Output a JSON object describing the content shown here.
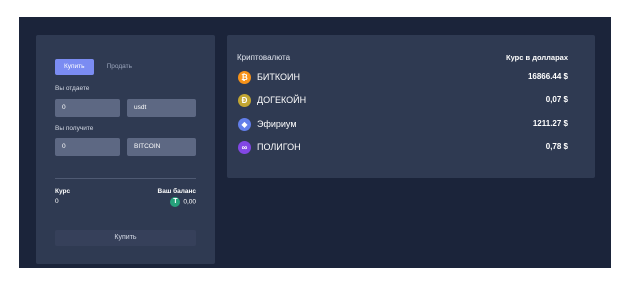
{
  "trade": {
    "tabs": [
      {
        "label": "Купить",
        "active": true
      },
      {
        "label": "Продать",
        "active": false
      }
    ],
    "give_label": "Вы отдаете",
    "give_amount": "0",
    "give_currency": "usdt",
    "ratio_label": "Вы получите",
    "receive_amount": "0",
    "receive_currency": "BITCOIN",
    "rate_label": "Курс",
    "rate_value": "0",
    "balance_label": "Ваш баланс",
    "balance_value": "0,00",
    "buy_button": "Купить"
  },
  "rates": {
    "header_name": "Криптовалюта",
    "header_price": "Курс в долларах",
    "rows": [
      {
        "name": "БИТКОИН",
        "price": "16866.44 $",
        "icon": "bitcoin-icon",
        "color": "#f7931a",
        "glyph": "₿"
      },
      {
        "name": "ДОГЕКОЙН",
        "price": "0,07 $",
        "icon": "dogecoin-icon",
        "color": "#c2a633",
        "glyph": "Ð"
      },
      {
        "name": "Эфириум",
        "price": "1211.27 $",
        "icon": "ethereum-icon",
        "color": "#627eea",
        "glyph": "◆"
      },
      {
        "name": "ПОЛИГОН",
        "price": "0,78 $",
        "icon": "polygon-icon",
        "color": "#8247e5",
        "glyph": "∞"
      }
    ]
  }
}
